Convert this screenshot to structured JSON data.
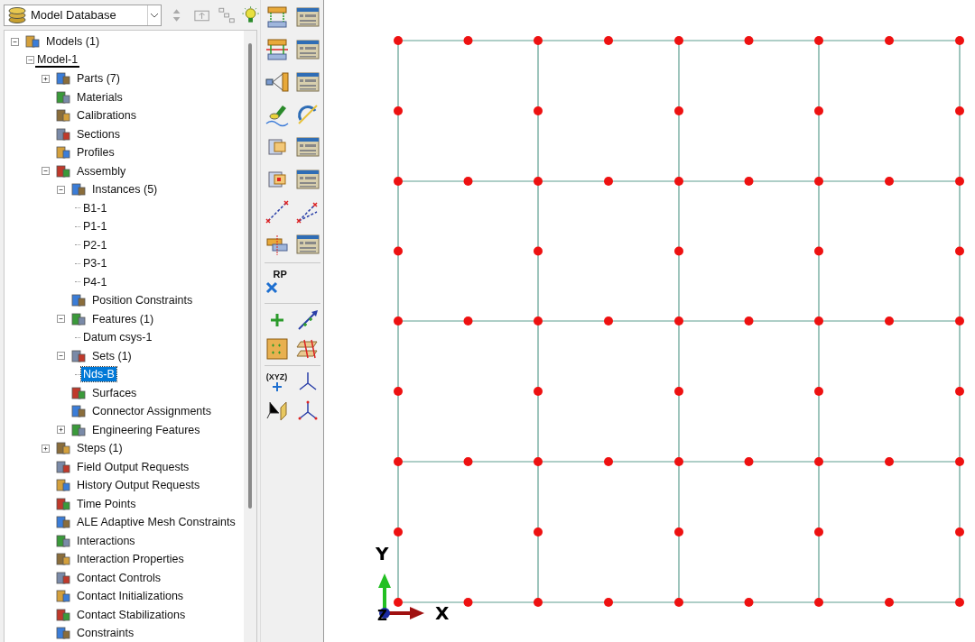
{
  "model_selector": {
    "value": "Model Database"
  },
  "tree": [
    {
      "label": "Models (1)",
      "kind": "group",
      "expanded": true,
      "selected": false,
      "children": [
        {
          "label": "Model-1",
          "kind": "model",
          "expanded": true,
          "selected": false,
          "current": true,
          "children": [
            {
              "label": "Parts (7)",
              "kind": "group",
              "expanded": false,
              "selected": false
            },
            {
              "label": "Materials",
              "kind": "group",
              "selected": false
            },
            {
              "label": "Calibrations",
              "kind": "group",
              "selected": false
            },
            {
              "label": "Sections",
              "kind": "group",
              "selected": false
            },
            {
              "label": "Profiles",
              "kind": "group",
              "selected": false
            },
            {
              "label": "Assembly",
              "kind": "group",
              "expanded": true,
              "selected": false,
              "children": [
                {
                  "label": "Instances (5)",
                  "kind": "group",
                  "expanded": true,
                  "selected": false,
                  "children": [
                    {
                      "label": "B1-1",
                      "kind": "leaf",
                      "selected": false
                    },
                    {
                      "label": "P1-1",
                      "kind": "leaf",
                      "selected": false
                    },
                    {
                      "label": "P2-1",
                      "kind": "leaf",
                      "selected": false
                    },
                    {
                      "label": "P3-1",
                      "kind": "leaf",
                      "selected": false
                    },
                    {
                      "label": "P4-1",
                      "kind": "leaf",
                      "selected": false
                    }
                  ]
                },
                {
                  "label": "Position Constraints",
                  "kind": "group",
                  "selected": false
                },
                {
                  "label": "Features (1)",
                  "kind": "group",
                  "expanded": true,
                  "selected": false,
                  "children": [
                    {
                      "label": "Datum csys-1",
                      "kind": "leaf",
                      "selected": false
                    }
                  ]
                },
                {
                  "label": "Sets (1)",
                  "kind": "group",
                  "expanded": true,
                  "selected": false,
                  "children": [
                    {
                      "label": "Nds-B",
                      "kind": "leaf",
                      "selected": true
                    }
                  ]
                },
                {
                  "label": "Surfaces",
                  "kind": "group",
                  "selected": false
                },
                {
                  "label": "Connector Assignments",
                  "kind": "group",
                  "selected": false
                },
                {
                  "label": "Engineering Features",
                  "kind": "group",
                  "expanded": false,
                  "selected": false
                }
              ]
            },
            {
              "label": "Steps (1)",
              "kind": "group",
              "expanded": false,
              "selected": false
            },
            {
              "label": "Field Output Requests",
              "kind": "group",
              "selected": false
            },
            {
              "label": "History Output Requests",
              "kind": "group",
              "selected": false
            },
            {
              "label": "Time Points",
              "kind": "group",
              "selected": false
            },
            {
              "label": "ALE Adaptive Mesh Constraints",
              "kind": "group",
              "selected": false
            },
            {
              "label": "Interactions",
              "kind": "group",
              "selected": false
            },
            {
              "label": "Interaction Properties",
              "kind": "group",
              "selected": false
            },
            {
              "label": "Contact Controls",
              "kind": "group",
              "selected": false
            },
            {
              "label": "Contact Initializations",
              "kind": "group",
              "selected": false
            },
            {
              "label": "Contact Stabilizations",
              "kind": "group",
              "selected": false
            },
            {
              "label": "Constraints",
              "kind": "group",
              "selected": false
            }
          ]
        }
      ]
    }
  ],
  "toolbox": {
    "reference_point_label": "RP",
    "coordinates_label": "(XYZ)"
  },
  "triad": {
    "x": "X",
    "y": "Y",
    "z": "Z"
  }
}
